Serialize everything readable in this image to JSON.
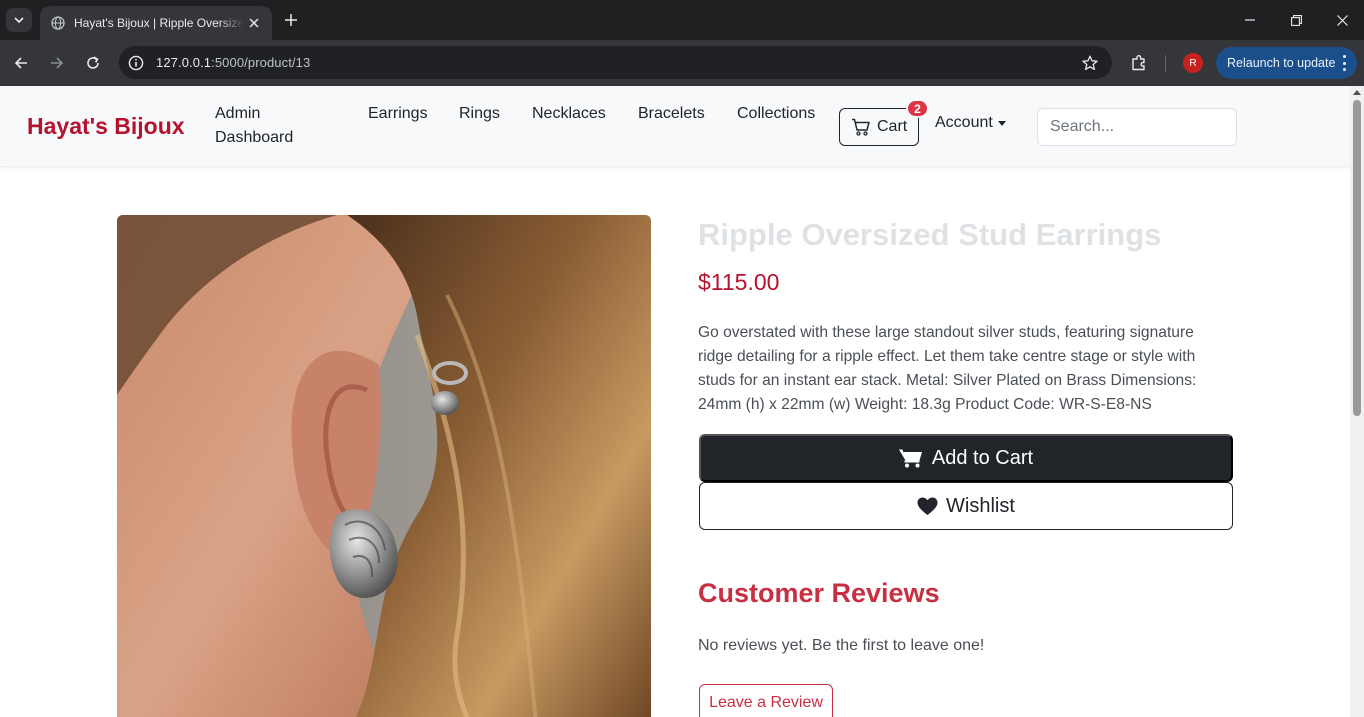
{
  "browser": {
    "tab_title": "Hayat's Bijoux | Ripple Oversized Stud Earrings",
    "url_host": "127.0.0.1",
    "url_rest": ":5000/product/13",
    "profile_initial": "R",
    "relaunch_label": "Relaunch to update",
    "icons": [
      "tab-search-icon",
      "globe-icon",
      "close-icon",
      "plus-icon",
      "minimize-icon",
      "restore-icon",
      "back-icon",
      "forward-icon",
      "reload-icon",
      "site-info-icon",
      "star-icon",
      "extensions-icon",
      "kebab-menu-icon"
    ]
  },
  "site": {
    "brand": "Hayat's Bijoux",
    "brand_color": "#b5122f",
    "nav": {
      "admin_line1": "Admin",
      "admin_line2": "Dashboard",
      "earrings": "Earrings",
      "rings": "Rings",
      "necklaces": "Necklaces",
      "bracelets": "Bracelets",
      "collections": "Collections",
      "cart_label": "Cart",
      "cart_count": "2",
      "account": "Account"
    },
    "search_placeholder": "Search..."
  },
  "product": {
    "title": "Ripple Oversized Stud Earrings",
    "price": "$115.00",
    "description": "Go overstated with these large standout silver studs, featuring signature ridge detailing for a ripple effect. Let them take centre stage or style with studs for an instant ear stack. Metal: Silver Plated on Brass Dimensions: 24mm (h) x 22mm (w) Weight: 18.3g Product Code: WR-S-E8-NS",
    "add_to_cart": "Add to Cart",
    "wishlist": "Wishlist"
  },
  "reviews": {
    "heading": "Customer Reviews",
    "empty_message": "No reviews yet. Be the first to leave one!",
    "leave_review": "Leave a Review",
    "accent_color": "#c92f42"
  }
}
